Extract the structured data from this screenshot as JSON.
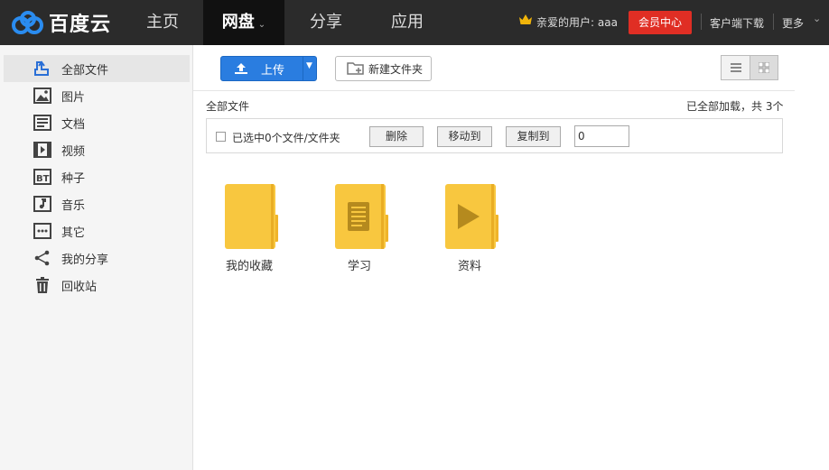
{
  "header": {
    "logo_text": "百度云",
    "nav": [
      {
        "label": "主页"
      },
      {
        "label": "网盘"
      },
      {
        "label": "分享"
      },
      {
        "label": "应用"
      }
    ],
    "user_text": "亲爱的用户: aaa",
    "vip_label": "会员中心",
    "client_download": "客户端下载",
    "more_label": "更多"
  },
  "sidebar": {
    "items": [
      {
        "label": "全部文件",
        "icon": "all-files-icon"
      },
      {
        "label": "图片",
        "icon": "image-icon"
      },
      {
        "label": "文档",
        "icon": "document-icon"
      },
      {
        "label": "视频",
        "icon": "video-icon"
      },
      {
        "label": "种子",
        "icon": "bt-icon"
      },
      {
        "label": "音乐",
        "icon": "music-icon"
      },
      {
        "label": "其它",
        "icon": "more-dots-icon"
      },
      {
        "label": "我的分享",
        "icon": "share-icon"
      },
      {
        "label": "回收站",
        "icon": "trash-icon"
      }
    ]
  },
  "toolbar": {
    "upload_label": "上传",
    "newfolder_label": "新建文件夹"
  },
  "breadcrumb": "全部文件",
  "load_status": "已全部加载，共 3个",
  "selection": {
    "text": "已选中0个文件/文件夹",
    "delete_label": "删除",
    "move_label": "移动到",
    "copy_label": "复制到",
    "input_value": "0"
  },
  "folders": [
    {
      "name": "我的收藏",
      "kind": "plain"
    },
    {
      "name": "学习",
      "kind": "document"
    },
    {
      "name": "资料",
      "kind": "video"
    }
  ],
  "colors": {
    "topbar": "#2b2b2b",
    "upload_blue": "#2a7de0",
    "vip_red": "#e02e24",
    "folder_yellow": "#f8c73f"
  }
}
